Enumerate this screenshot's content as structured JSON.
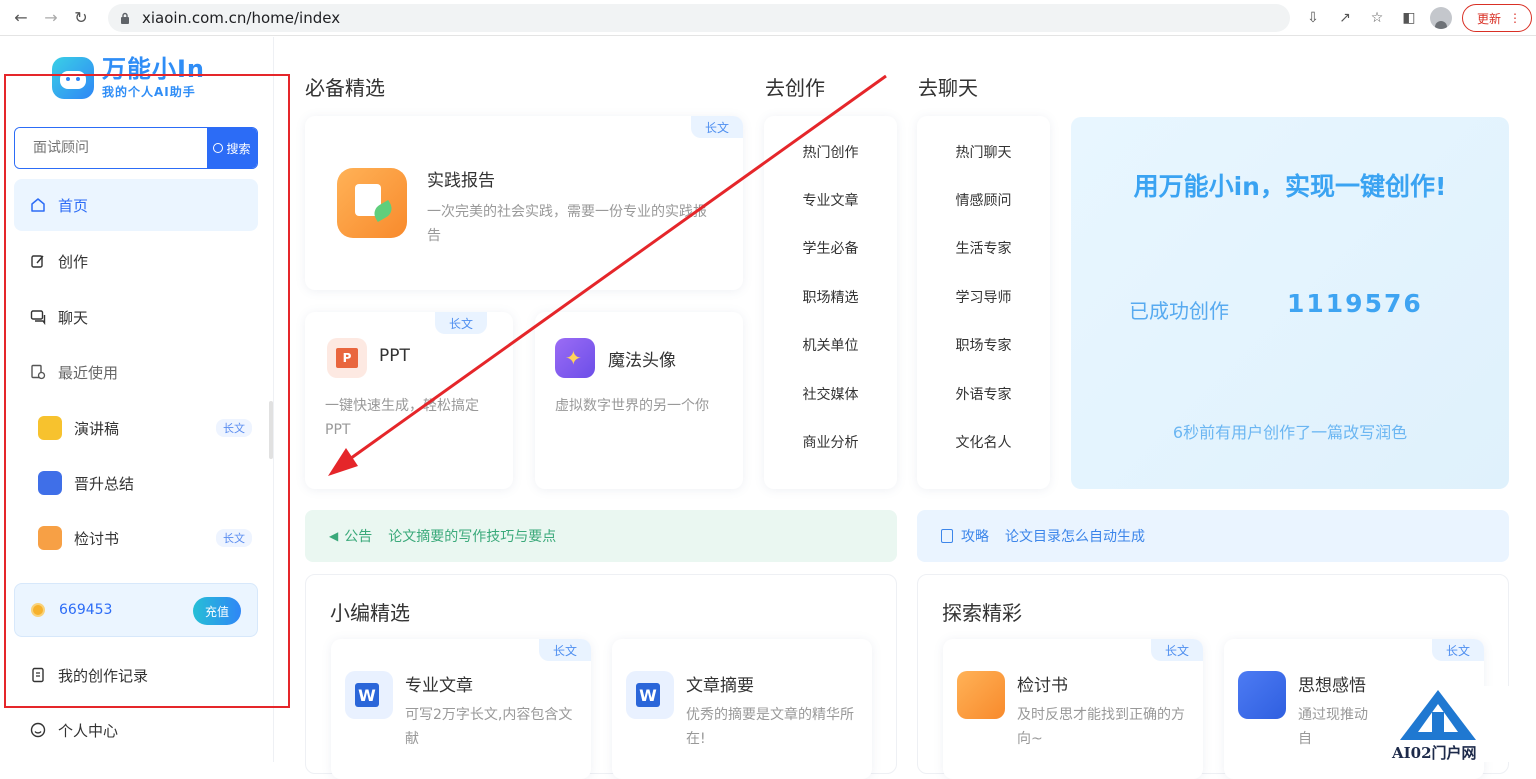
{
  "browser": {
    "url": "xiaoin.com.cn/home/index",
    "update_label": "更新"
  },
  "sidebar": {
    "logo_title": "万能小In",
    "logo_subtitle": "我的个人AI助手",
    "search_placeholder": "面试顾问",
    "search_button": "搜索",
    "menu": [
      {
        "label": "首页",
        "icon": "home-icon",
        "active": true
      },
      {
        "label": "创作",
        "icon": "edit-icon"
      },
      {
        "label": "聊天",
        "icon": "chat-icon"
      },
      {
        "label": "最近使用",
        "icon": "recent-icon"
      }
    ],
    "recent": [
      {
        "label": "演讲稿",
        "tag": "长文",
        "color": "#f7c22e"
      },
      {
        "label": "晋升总结",
        "tag": "",
        "color": "#3f6fe8"
      },
      {
        "label": "检讨书",
        "tag": "长文",
        "color": "#f7a045"
      }
    ],
    "credits": "669453",
    "recharge_label": "充值",
    "bottom": [
      {
        "label": "我的创作记录",
        "icon": "record-icon"
      },
      {
        "label": "个人中心",
        "icon": "user-center-icon"
      }
    ]
  },
  "main": {
    "featured_title": "必备精选",
    "create_title": "去创作",
    "chat_title": "去聊天",
    "featured": {
      "tag": "长文",
      "title": "实践报告",
      "desc": "一次完美的社会实践，需要一份专业的实践报告"
    },
    "ppt": {
      "tag": "长文",
      "title": "PPT",
      "desc": "一键快速生成，轻松搞定PPT"
    },
    "avatar": {
      "title": "魔法头像",
      "desc": "虚拟数字世界的另一个你"
    },
    "create_list": [
      "热门创作",
      "专业文章",
      "学生必备",
      "职场精选",
      "机关单位",
      "社交媒体",
      "商业分析"
    ],
    "chat_list": [
      "热门聊天",
      "情感顾问",
      "生活专家",
      "学习导师",
      "职场专家",
      "外语专家",
      "文化名人"
    ],
    "promo": {
      "title": "用万能小in，实现一键创作!",
      "count_label": "已成功创作",
      "count": "1119576",
      "recent": "6秒前有用户创作了一篇改写润色"
    },
    "notice": {
      "type": "公告",
      "text": "论文摘要的写作技巧与要点"
    },
    "guide": {
      "type": "攻略",
      "text": "论文目录怎么自动生成"
    },
    "editor_title": "小编精选",
    "explore_title": "探索精彩",
    "editor_items": [
      {
        "tag": "长文",
        "title": "专业文章",
        "desc": "可写2万字长文,内容包含文献"
      },
      {
        "tag": "",
        "title": "文章摘要",
        "desc": "优秀的摘要是文章的精华所在!"
      }
    ],
    "explore_items": [
      {
        "tag": "长文",
        "title": "检讨书",
        "desc": "及时反思才能找到正确的方向~"
      },
      {
        "tag": "长文",
        "title": "思想感悟",
        "desc": "通过现推动自"
      }
    ]
  },
  "watermark": "AI02门户网"
}
